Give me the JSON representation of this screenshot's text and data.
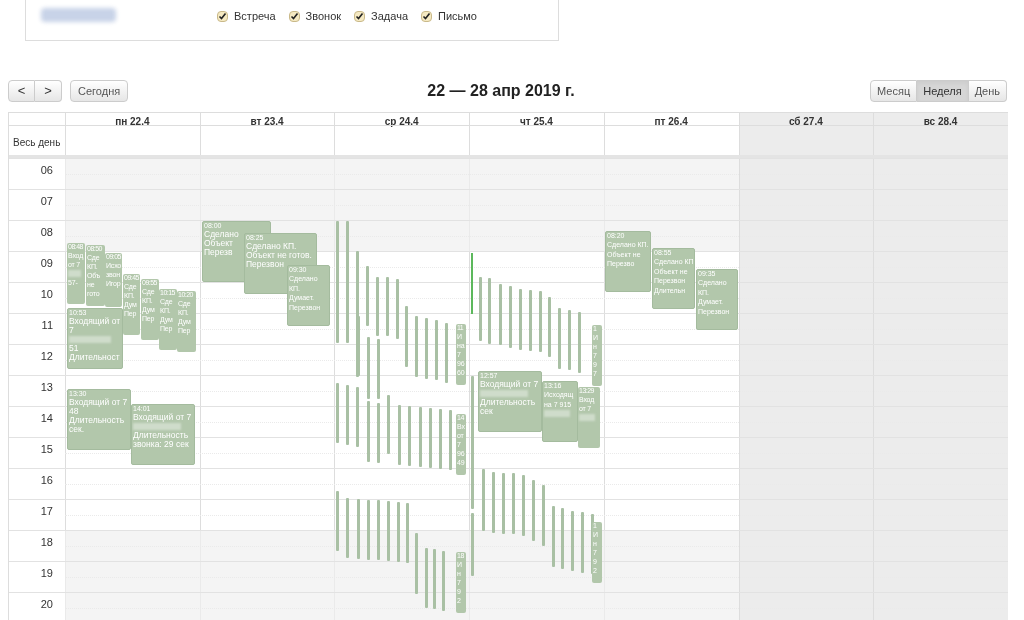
{
  "filters": [
    {
      "label": "Встреча",
      "checked": true
    },
    {
      "label": "Звонок",
      "checked": true
    },
    {
      "label": "Задача",
      "checked": true
    },
    {
      "label": "Письмо",
      "checked": true
    }
  ],
  "toolbar": {
    "prev": "<",
    "next": ">",
    "today": "Сегодня",
    "title": "22 — 28 апр 2019 г.",
    "views": [
      {
        "label": "Месяц",
        "selected": false
      },
      {
        "label": "Неделя",
        "selected": true
      },
      {
        "label": "День",
        "selected": false
      }
    ]
  },
  "calendar": {
    "all_day_label": "Весь день",
    "days": [
      {
        "label": "пн 22.4",
        "weekend": false
      },
      {
        "label": "вт 23.4",
        "weekend": false
      },
      {
        "label": "ср 24.4",
        "weekend": false
      },
      {
        "label": "чт 25.4",
        "weekend": false
      },
      {
        "label": "пт 26.4",
        "weekend": false
      },
      {
        "label": "сб 27.4",
        "weekend": true
      },
      {
        "label": "вс 28.4",
        "weekend": true
      }
    ],
    "hours": [
      "06",
      "07",
      "08",
      "09",
      "10",
      "11",
      "12",
      "13",
      "14",
      "15",
      "16",
      "17",
      "18",
      "19",
      "20"
    ],
    "events": [
      {
        "time": "08:48",
        "lines": [
          {
            "kind": "text",
            "text": "Вход"
          },
          {
            "kind": "text",
            "text": "от 7"
          },
          {
            "kind": "redacted"
          },
          {
            "kind": "text",
            "text": "57-"
          }
        ]
      },
      {
        "time": "08:50",
        "lines": [
          {
            "kind": "text",
            "text": "Сде"
          },
          {
            "kind": "text",
            "text": "КП."
          },
          {
            "kind": "text",
            "text": "Объ"
          },
          {
            "kind": "text",
            "text": "не"
          },
          {
            "kind": "text",
            "text": "гото"
          }
        ]
      },
      {
        "time": "09:05",
        "lines": [
          {
            "kind": "text",
            "text": "Исхо"
          },
          {
            "kind": "text",
            "text": "звон"
          },
          {
            "kind": "text",
            "text": "Игор"
          }
        ]
      },
      {
        "time": "09:45",
        "lines": [
          {
            "kind": "text",
            "text": "Сде"
          },
          {
            "kind": "text",
            "text": "КП."
          },
          {
            "kind": "text",
            "text": "Дум"
          },
          {
            "kind": "text",
            "text": "Пер"
          }
        ]
      },
      {
        "time": "09:55",
        "lines": [
          {
            "kind": "text",
            "text": "Сде"
          },
          {
            "kind": "text",
            "text": "КП."
          },
          {
            "kind": "text",
            "text": "Дум"
          },
          {
            "kind": "text",
            "text": "Пер"
          }
        ]
      },
      {
        "time": "10:15",
        "lines": [
          {
            "kind": "text",
            "text": "Сде"
          },
          {
            "kind": "text",
            "text": "КП."
          },
          {
            "kind": "text",
            "text": "Дум"
          },
          {
            "kind": "text",
            "text": "Пер"
          }
        ]
      },
      {
        "time": "10:20",
        "lines": [
          {
            "kind": "text",
            "text": "Сде"
          },
          {
            "kind": "text",
            "text": "КП."
          },
          {
            "kind": "text",
            "text": "Дум"
          },
          {
            "kind": "text",
            "text": "Пер"
          }
        ]
      },
      {
        "time": "10:53",
        "lines": [
          {
            "kind": "text",
            "text": "Входящий от"
          },
          {
            "kind": "text",
            "text": "7"
          },
          {
            "kind": "redacted"
          },
          {
            "kind": "text",
            "text": "51"
          },
          {
            "kind": "text",
            "text": "Длительност"
          }
        ]
      },
      {
        "time": "13:30",
        "lines": [
          {
            "kind": "text",
            "text": "Входящий от 7"
          },
          {
            "kind": "text",
            "text": "48"
          },
          {
            "kind": "text",
            "text": "Длительность"
          },
          {
            "kind": "text",
            "text": "сек."
          }
        ]
      },
      {
        "time": "14:01",
        "lines": [
          {
            "kind": "text",
            "text": "Входящий от 7"
          },
          {
            "kind": "redacted"
          },
          {
            "kind": "text",
            "text": "Длительность"
          },
          {
            "kind": "text",
            "text": "звонка: 29 сек"
          }
        ]
      },
      {
        "time": "08:00",
        "lines": [
          {
            "kind": "text",
            "text": "Сделано"
          },
          {
            "kind": "text",
            "text": "Объект"
          },
          {
            "kind": "text",
            "text": "Перезв"
          }
        ]
      },
      {
        "time": "08:25",
        "lines": [
          {
            "kind": "text",
            "text": "Сделано КП."
          },
          {
            "kind": "text",
            "text": "Объект не готов."
          },
          {
            "kind": "text",
            "text": "Перезвон"
          }
        ]
      },
      {
        "time": "09:30",
        "lines": [
          {
            "kind": "text",
            "text": "Сделано"
          },
          {
            "kind": "text",
            "text": "КП."
          },
          {
            "kind": "text",
            "text": "Думает."
          },
          {
            "kind": "text",
            "text": "Перезвон"
          }
        ]
      },
      {
        "time": "11",
        "lines": [
          {
            "kind": "text",
            "text": "И"
          },
          {
            "kind": "text",
            "text": "на"
          },
          {
            "kind": "text",
            "text": "7"
          },
          {
            "kind": "text",
            "text": "96"
          },
          {
            "kind": "text",
            "text": "60"
          }
        ]
      },
      {
        "time": "14",
        "lines": [
          {
            "kind": "text",
            "text": "Вх"
          },
          {
            "kind": "text",
            "text": "от"
          },
          {
            "kind": "text",
            "text": "7"
          },
          {
            "kind": "text",
            "text": "96"
          },
          {
            "kind": "text",
            "text": "49"
          }
        ]
      },
      {
        "time": "18",
        "lines": [
          {
            "kind": "text",
            "text": "И"
          },
          {
            "kind": "text",
            "text": "н"
          },
          {
            "kind": "text",
            "text": "7"
          },
          {
            "kind": "text",
            "text": "9"
          },
          {
            "kind": "text",
            "text": "2"
          }
        ]
      },
      {
        "time": "1",
        "lines": [
          {
            "kind": "text",
            "text": "И"
          },
          {
            "kind": "text",
            "text": "н"
          },
          {
            "kind": "text",
            "text": "7"
          },
          {
            "kind": "text",
            "text": "9"
          },
          {
            "kind": "text",
            "text": "7"
          }
        ]
      },
      {
        "time": "12:57",
        "lines": [
          {
            "kind": "text",
            "text": "Входящий от 7"
          },
          {
            "kind": "redacted"
          },
          {
            "kind": "text",
            "text": "Длительность"
          },
          {
            "kind": "text",
            "text": "сек"
          }
        ]
      },
      {
        "time": "13:16",
        "lines": [
          {
            "kind": "text",
            "text": "Исходящ"
          },
          {
            "kind": "text",
            "text": "на 7 915"
          },
          {
            "kind": "redacted"
          }
        ]
      },
      {
        "time": "13:29",
        "lines": [
          {
            "kind": "text",
            "text": "Вход"
          },
          {
            "kind": "text",
            "text": "от 7"
          },
          {
            "kind": "redacted"
          }
        ]
      },
      {
        "time": "1",
        "lines": [
          {
            "kind": "text",
            "text": "И"
          },
          {
            "kind": "text",
            "text": "н"
          },
          {
            "kind": "text",
            "text": "7"
          },
          {
            "kind": "text",
            "text": "9"
          },
          {
            "kind": "text",
            "text": "2"
          }
        ]
      },
      {
        "time": "08:20",
        "lines": [
          {
            "kind": "text",
            "text": "Сделано КП."
          },
          {
            "kind": "text",
            "text": "Объект не"
          },
          {
            "kind": "text",
            "text": "Перезво"
          }
        ]
      },
      {
        "time": "08:55",
        "lines": [
          {
            "kind": "text",
            "text": "Сделано КП."
          },
          {
            "kind": "text",
            "text": "Объект не"
          },
          {
            "kind": "text",
            "text": "Перезвон"
          },
          {
            "kind": "text",
            "text": "Длительн"
          }
        ]
      },
      {
        "time": "09:35",
        "lines": [
          {
            "kind": "text",
            "text": "Сделано"
          },
          {
            "kind": "text",
            "text": "КП."
          },
          {
            "kind": "text",
            "text": "Думает."
          },
          {
            "kind": "text",
            "text": "Перезвон"
          }
        ]
      }
    ]
  }
}
